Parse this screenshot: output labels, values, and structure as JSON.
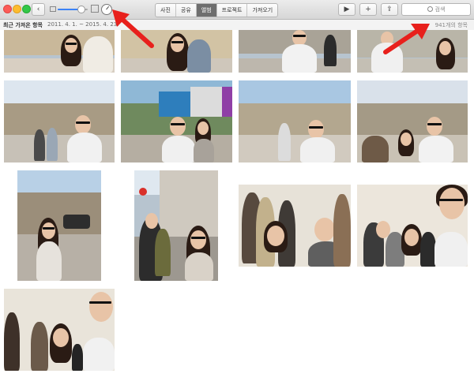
{
  "toolbar": {
    "back_label": "‹",
    "segments": [
      {
        "label": "사진",
        "active": false
      },
      {
        "label": "공유",
        "active": false
      },
      {
        "label": "앨범",
        "active": true
      },
      {
        "label": "프로젝트",
        "active": false
      },
      {
        "label": "가져오기",
        "active": false
      }
    ],
    "play_label": "▶",
    "add_label": "+",
    "share_label": "⇪",
    "search_placeholder": "검색",
    "zoom_slider_value": 0.75
  },
  "subheader": {
    "title": "최근 가져온 항목",
    "date_range": "2011. 4. 1. ~ 2015. 4. 23.",
    "item_count": "941개의 항목"
  },
  "icons": {
    "history": "history-icon",
    "search": "search-icon",
    "share": "share-icon",
    "play": "play-icon",
    "add": "add-icon",
    "back": "chevron-left-icon"
  },
  "colors": {
    "active_segment": "#6e6e6e",
    "annotation_arrow": "#e8201c",
    "close": "#fc5b57",
    "minimize": "#fdbc2f",
    "maximize": "#33c748"
  }
}
